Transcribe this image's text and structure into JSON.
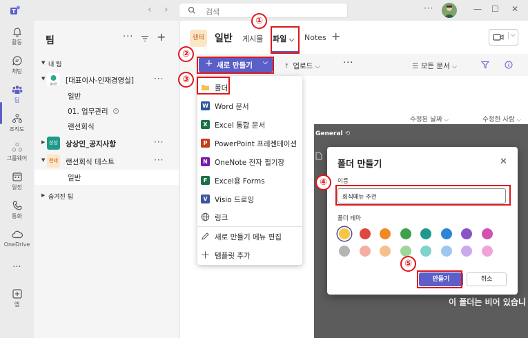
{
  "titlebar": {
    "search_placeholder": "검색",
    "back_icon": "chevron-left-icon",
    "forward_icon": "chevron-right-icon",
    "more": "···",
    "minimize": "—",
    "maximize": "☐",
    "close": "✕"
  },
  "rail": {
    "items": [
      {
        "label": "활동",
        "icon": "bell-icon"
      },
      {
        "label": "채팅",
        "icon": "chat-icon"
      },
      {
        "label": "팀",
        "icon": "teams-icon"
      },
      {
        "label": "조직도",
        "icon": "org-chart-icon"
      },
      {
        "label": "그룹웨어",
        "icon": "groupware-icon"
      },
      {
        "label": "일정",
        "icon": "calendar-icon"
      },
      {
        "label": "통화",
        "icon": "phone-icon"
      },
      {
        "label": "OneDrive",
        "icon": "cloud-icon"
      },
      {
        "label": "···",
        "icon": "more-icon"
      },
      {
        "label": "앱",
        "icon": "add-app-icon"
      }
    ]
  },
  "teams": {
    "title": "팀",
    "more": "···",
    "section_my": "내 팀",
    "team1": {
      "name": "[대표이사-인재경영실]",
      "avatar_text": "상상인"
    },
    "team1_channels": [
      "일반",
      "01. 업무관리",
      "랜선회식"
    ],
    "team2": {
      "name": "상상인_공지사항",
      "avatar_text": "상상"
    },
    "team3": {
      "name": "랜선회식 테스트",
      "avatar_text": "랜테"
    },
    "team3_channels": [
      "일반"
    ],
    "section_hidden": "숨겨진 팀"
  },
  "main": {
    "avatar_text": "랜테",
    "channel_title": "일반",
    "tabs": [
      "게시물",
      "파일",
      "Notes"
    ],
    "active_tab": "파일",
    "tab_add": "+",
    "toolbar": {
      "new_label": "새로 만들기",
      "upload_label": "업로드",
      "more": "···",
      "all_docs_label": "모든 문서"
    },
    "columns": [
      "수정된 날짜",
      "수정한 사람"
    ],
    "crumb": "General",
    "empty_text": "이 폴더는 비어 있습니"
  },
  "new_menu": {
    "items": [
      {
        "label": "폴더",
        "icon": "folder-icon",
        "color": "#f2c14e",
        "glyph": ""
      },
      {
        "label": "Word 문서",
        "icon": "word-icon",
        "color": "#2b5797",
        "glyph": "W"
      },
      {
        "label": "Excel 통합 문서",
        "icon": "excel-icon",
        "color": "#1e7145",
        "glyph": "X"
      },
      {
        "label": "PowerPoint 프레젠테이션",
        "icon": "powerpoint-icon",
        "color": "#c43e1c",
        "glyph": "P"
      },
      {
        "label": "OneNote 전자 필기장",
        "icon": "onenote-icon",
        "color": "#7719aa",
        "glyph": "N"
      },
      {
        "label": "Excel용 Forms",
        "icon": "forms-icon",
        "color": "#1e7145",
        "glyph": "F"
      },
      {
        "label": "Visio 드로잉",
        "icon": "visio-icon",
        "color": "#3955a3",
        "glyph": "V"
      },
      {
        "label": "링크",
        "icon": "globe-icon",
        "color": "",
        "glyph": ""
      },
      {
        "label": "새로 만들기 메뉴 편집",
        "icon": "pencil-icon",
        "color": "",
        "glyph": ""
      },
      {
        "label": "템플릿 추가",
        "icon": "plus-icon",
        "color": "",
        "glyph": ""
      }
    ]
  },
  "dialog": {
    "title": "폴더 만들기",
    "name_label": "이름",
    "name_value": "회식메뉴 추천",
    "theme_label": "폴더 테마",
    "colors_row1": [
      "#f6c644",
      "#e0463c",
      "#f08a24",
      "#3fa24a",
      "#1f9a8a",
      "#2f84d6",
      "#8c52c7",
      "#d451b0"
    ],
    "colors_row2": [
      "#b4b4b4",
      "#f4aea6",
      "#f6c08d",
      "#9ed69e",
      "#7fd3cc",
      "#9cc8f0",
      "#cba9ee",
      "#f0a3d8"
    ],
    "selected_color_index": 0,
    "create_label": "만들기",
    "cancel_label": "취소"
  },
  "annotations": [
    "①",
    "②",
    "③",
    "④",
    "⑤"
  ]
}
